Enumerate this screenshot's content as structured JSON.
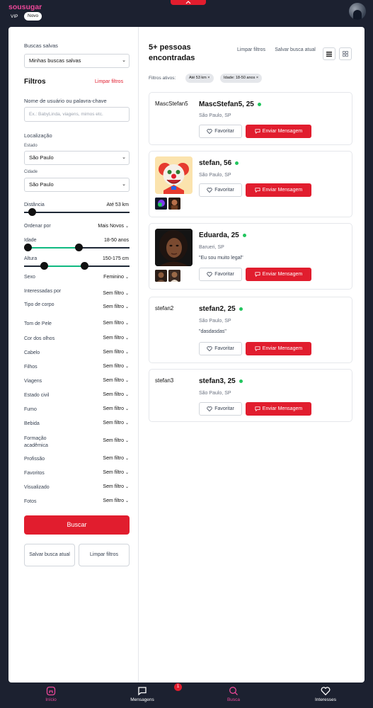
{
  "header": {
    "brand": "sousugar",
    "vip_label": "VIP",
    "novo_label": "Novo"
  },
  "left": {
    "saved_label": "Buscas salvas",
    "saved_value": "Minhas buscas salvas",
    "filters_title": "Filtros",
    "clear_filters": "Limpar filtros",
    "username_label": "Nome de usuário ou palavra-chave",
    "username_placeholder": "Ex.: BabyLinda, viagens, mimos etc.",
    "location_label": "Localização",
    "state_label": "Estado",
    "state_value": "São Paulo",
    "city_label": "Cidade",
    "city_value": "São Paulo",
    "distance_label": "Distância",
    "distance_value": "Até 53 km",
    "distance_fraction": 0.04,
    "order_label": "Ordenar por",
    "order_value": "Mais Novos",
    "age_label": "Idade",
    "age_value": "18-50 anos",
    "age_range_fraction": [
      0.0,
      0.52
    ],
    "height_label": "Altura",
    "height_value": "150-175 cm",
    "height_range_fraction": [
      0.17,
      0.58
    ],
    "sexo_label": "Sexo",
    "sexo_value": "Feminino",
    "rows": [
      {
        "label": "Interessadas por",
        "value": "Sem filtro"
      },
      {
        "label": "Tipo de corpo",
        "value": "Sem filtro"
      },
      {
        "label": "Tom de Pele",
        "value": "Sem filtro"
      },
      {
        "label": "Cor dos olhos",
        "value": "Sem filtro"
      },
      {
        "label": "Cabelo",
        "value": "Sem filtro"
      },
      {
        "label": "Filhos",
        "value": "Sem filtro"
      },
      {
        "label": "Viagens",
        "value": "Sem filtro"
      },
      {
        "label": "Estado civil",
        "value": "Sem filtro"
      },
      {
        "label": "Fumo",
        "value": "Sem filtro"
      },
      {
        "label": "Bebida",
        "value": "Sem filtro"
      },
      {
        "label": "Formação acadêmica",
        "value": "Sem filtro"
      },
      {
        "label": "Profissão",
        "value": "Sem filtro"
      },
      {
        "label": "Favoritos",
        "value": "Sem filtro"
      },
      {
        "label": "Visualizado",
        "value": "Sem filtro"
      },
      {
        "label": "Fotos",
        "value": "Sem filtro"
      }
    ],
    "search_button": "Buscar",
    "save_search_button": "Salvar busca atual",
    "clear_button": "Limpar filtros"
  },
  "results": {
    "title": "5+ pessoas encontradas",
    "clear_filters": "Limpar filtros",
    "save_search": "Salvar busca atual",
    "active_filters_label": "Filtros ativos:",
    "active_filters": [
      "Até 53 km ×",
      "Idade: 18-50 anos ×"
    ],
    "favorite_label": "Favoritar",
    "message_label": "Enviar Mensagem",
    "profiles": [
      {
        "username": "MascStefan5",
        "name": "MascStefan5, 25",
        "location": "São Paulo, SP",
        "bio": ""
      },
      {
        "username": "",
        "name": "stefan, 56",
        "location": "São Paulo, SP",
        "bio": ""
      },
      {
        "username": "",
        "name": "Eduarda, 25",
        "location": "Barueri, SP",
        "bio": "\"Eu sou muito legal\""
      },
      {
        "username": "stefan2",
        "name": "stefan2, 25",
        "location": "São Paulo, SP",
        "bio": "\"dasdasdas\""
      },
      {
        "username": "stefan3",
        "name": "stefan3, 25",
        "location": "São Paulo, SP",
        "bio": ""
      }
    ]
  },
  "nav": {
    "items": [
      "Início",
      "Mensagens",
      "Busca",
      "Interesses"
    ],
    "messages_badge": "1"
  },
  "colors": {
    "brand_pink": "#ec4899",
    "accent_red": "#e11d2e",
    "online_green": "#22c55e",
    "slider_green": "#10b981",
    "dark_bg": "#1c2130"
  }
}
